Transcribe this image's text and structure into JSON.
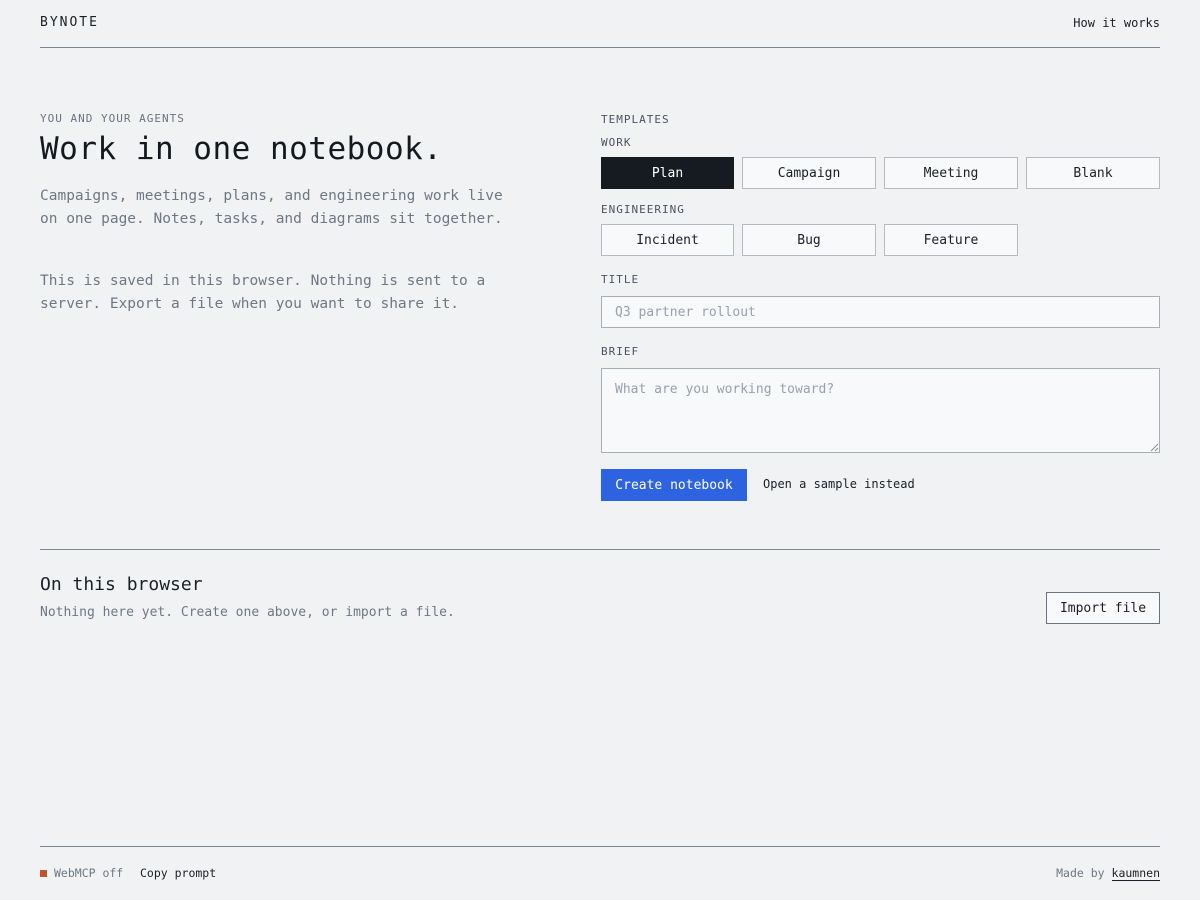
{
  "header": {
    "logo": "BYNOTE",
    "how_link": "How it works"
  },
  "hero": {
    "eyebrow": "YOU AND YOUR AGENTS",
    "headline": "Work in one notebook.",
    "intro_1": "Campaigns, meetings, plans, and engineering work live on one page. Notes, tasks, and diagrams sit together.",
    "intro_2": "This is saved in this browser. Nothing is sent to a server. Export a file when you want to share it."
  },
  "templates": {
    "label": "TEMPLATES",
    "work_label": "WORK",
    "work": [
      {
        "label": "Plan",
        "selected": true
      },
      {
        "label": "Campaign",
        "selected": false
      },
      {
        "label": "Meeting",
        "selected": false
      },
      {
        "label": "Blank",
        "selected": false
      }
    ],
    "engineering_label": "ENGINEERING",
    "engineering": [
      {
        "label": "Incident"
      },
      {
        "label": "Bug"
      },
      {
        "label": "Feature"
      }
    ]
  },
  "form": {
    "title_label": "TITLE",
    "title_value": "",
    "title_placeholder": "Q3 partner rollout",
    "brief_label": "BRIEF",
    "brief_value": "",
    "brief_placeholder": "What are you working toward?",
    "create_label": "Create notebook",
    "sample_label": "Open a sample instead"
  },
  "browser": {
    "title": "On this browser",
    "empty_text": "Nothing here yet. Create one above, or import a file.",
    "import_label": "Import file"
  },
  "footer": {
    "status_text": "WebMCP off",
    "status_color": "#c2532a",
    "copy_prompt": "Copy prompt",
    "made_by_prefix": "Made by",
    "made_by_name": "kaumnen"
  },
  "colors": {
    "background": "#f1f2f4",
    "accent": "#2d63e0",
    "selected": "#161b22"
  }
}
